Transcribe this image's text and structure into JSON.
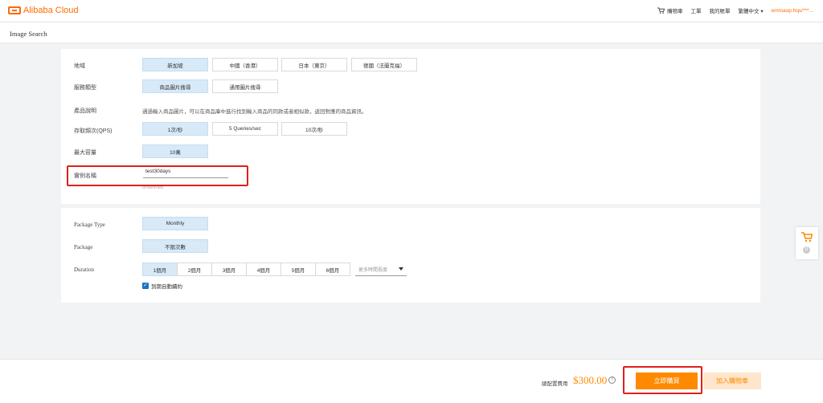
{
  "header": {
    "logo_text": "Alibaba Cloud",
    "nav": {
      "cart": "購物車",
      "ticket": "工單",
      "console": "我的賬單",
      "language": "繁體中文",
      "user": "emmaop.hqs/***..."
    }
  },
  "page": {
    "title": "Image Search"
  },
  "form": {
    "region": {
      "label": "地域",
      "options": [
        "新加坡",
        "中國（香港）",
        "日本（東京）",
        "德國（法蘭克福）"
      ],
      "selected": "新加坡"
    },
    "service_type": {
      "label": "服務類型",
      "options": [
        "商品圖片搜尋",
        "通用圖片搜尋"
      ],
      "selected": "商品圖片搜尋"
    },
    "product_desc": {
      "label": "產品說明",
      "text": "通過輸入商品圖片，可以在商品庫中進行找到輸入商品的同款或者相似款，返回對應的商品資訊。"
    },
    "qps": {
      "label": "存取頻次(QPS)",
      "options": [
        "1次/秒",
        "5 Queries/sec",
        "10次/秒"
      ],
      "selected": "1次/秒"
    },
    "capacity": {
      "label": "最大容量",
      "value": "10萬"
    },
    "instance_name": {
      "label": "實例名稱",
      "value": "test30days",
      "error": "undefined"
    }
  },
  "billing": {
    "package_type": {
      "label": "Package Type",
      "value": "Monthly"
    },
    "package": {
      "label": "Package",
      "value": "不限次數"
    },
    "duration": {
      "label": "Duration",
      "options": [
        "1個月",
        "2個月",
        "3個月",
        "4個月",
        "5個月",
        "6個月"
      ],
      "selected": "1個月",
      "more_placeholder": "更多時間長度"
    },
    "auto_renew": {
      "label": "到期自動續約",
      "checked": true
    }
  },
  "footer": {
    "total_label": "總配置費用",
    "price": "$300.00",
    "help_icon": "?",
    "buy_now": "立即購買",
    "add_to_cart": "加入購物車",
    "null_badge": "null"
  },
  "float_cart": {
    "count": "0"
  },
  "colors": {
    "accent": "#ff8a00",
    "selected_bg": "#d8e9f7",
    "highlight": "#e0201a"
  }
}
